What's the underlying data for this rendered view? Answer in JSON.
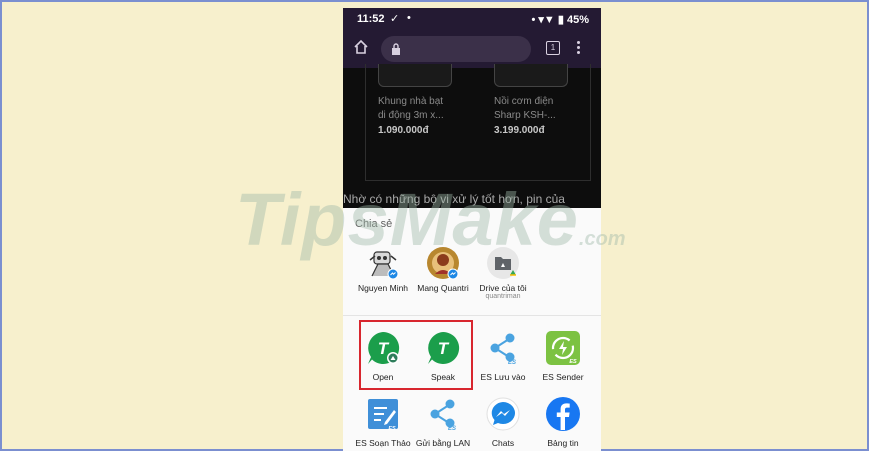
{
  "status_bar": {
    "time": "11:52",
    "battery": "45%"
  },
  "products": [
    {
      "name_line1": "Khung nhà bạt",
      "name_line2": "di động 3m x...",
      "price": "1.090.000đ"
    },
    {
      "name_line1": "Nồi cơm điện",
      "name_line2": "Sharp KSH-...",
      "price": "3.199.000đ"
    }
  ],
  "article_text": "Nhờ có những bộ vi xử lý tốt hơn, pin của",
  "share_sheet": {
    "title": "Chia sẻ",
    "direct_targets": [
      {
        "label": "Nguyen Minh",
        "sub": "",
        "icon": "messenger-contact-avatar"
      },
      {
        "label": "Mang Quantri",
        "sub": "",
        "icon": "messenger-contact-avatar"
      },
      {
        "label": "Drive của tôi",
        "sub": "quantriman",
        "icon": "google-drive-folder-icon"
      }
    ],
    "apps_row1": [
      {
        "label": "Open",
        "icon": "t2s-open-icon"
      },
      {
        "label": "Speak",
        "icon": "t2s-speak-icon"
      },
      {
        "label": "ES Lưu vào",
        "icon": "es-share-icon"
      },
      {
        "label": "ES Sender",
        "icon": "es-sender-icon"
      }
    ],
    "apps_row2": [
      {
        "label": "ES Soạn Thảo",
        "icon": "es-editor-icon"
      },
      {
        "label": "Gửi bằng LAN",
        "icon": "es-lan-share-icon"
      },
      {
        "label": "Chats",
        "icon": "messenger-icon"
      },
      {
        "label": "Bảng tin",
        "icon": "facebook-icon"
      }
    ]
  },
  "tab_count": "1",
  "watermark": {
    "main": "TipsMake",
    "suffix": ".com"
  },
  "colors": {
    "highlight": "#d8262e",
    "frame": "#7b8fd0",
    "background": "#f7f0cd"
  }
}
